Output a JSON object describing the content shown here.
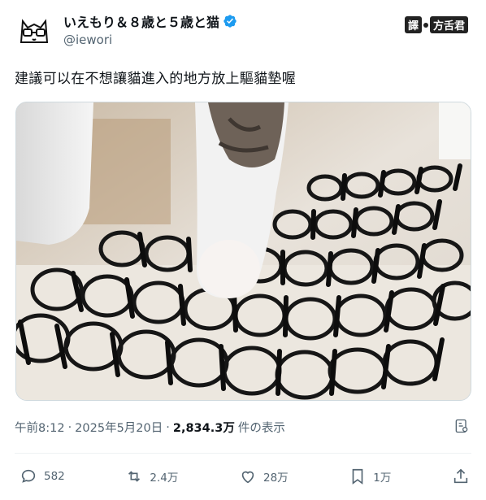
{
  "author": {
    "display_name": "いえもり＆８歳と５歳と猫",
    "handle": "@iewori",
    "verified_icon": "verified-badge-icon"
  },
  "watermark": {
    "left": "譯",
    "right": "方舌君"
  },
  "tweet": {
    "text": "建議可以在不想讓貓進入的地方放上驅貓墊喔"
  },
  "meta": {
    "time": "午前8:12",
    "separator": "·",
    "date": "2025年5月20日",
    "views_value": "2,834.3万",
    "views_label": "件の表示"
  },
  "actions": {
    "replies": "582",
    "reposts": "2.4万",
    "likes": "28万",
    "bookmarks": "1万"
  },
  "colors": {
    "accent": "#1d9bf0",
    "muted": "#536471",
    "text": "#0f1419"
  }
}
